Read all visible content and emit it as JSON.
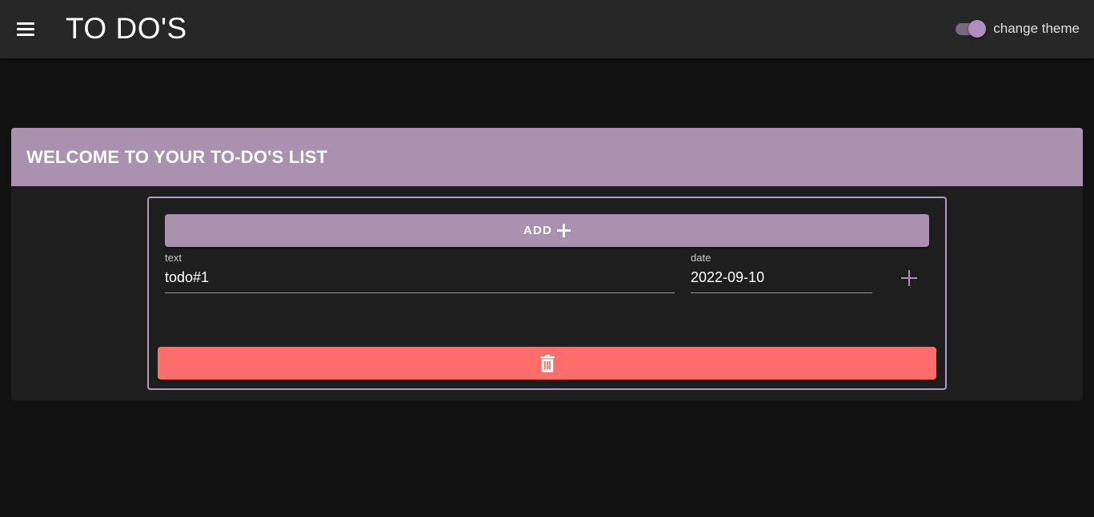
{
  "appbar": {
    "title": "TO DO'S",
    "menu_icon": "menu-icon",
    "theme_toggle": {
      "label": "change theme",
      "checked": true
    }
  },
  "card": {
    "title": "WELCOME TO YOUR TO-DO'S LIST"
  },
  "todo": {
    "add_button_label": "ADD",
    "add_icon": "plus-icon",
    "text_field": {
      "label": "text",
      "value": "todo#1"
    },
    "date_field": {
      "label": "date",
      "value": "2022-09-10"
    },
    "add_date_icon": "plus-icon",
    "delete_icon": "trash-icon"
  },
  "colors": {
    "accent": "#aa91b0",
    "delete": "#ff6e6b",
    "background": "#121212",
    "appbar": "#272727",
    "surface": "#1e1e1e"
  }
}
